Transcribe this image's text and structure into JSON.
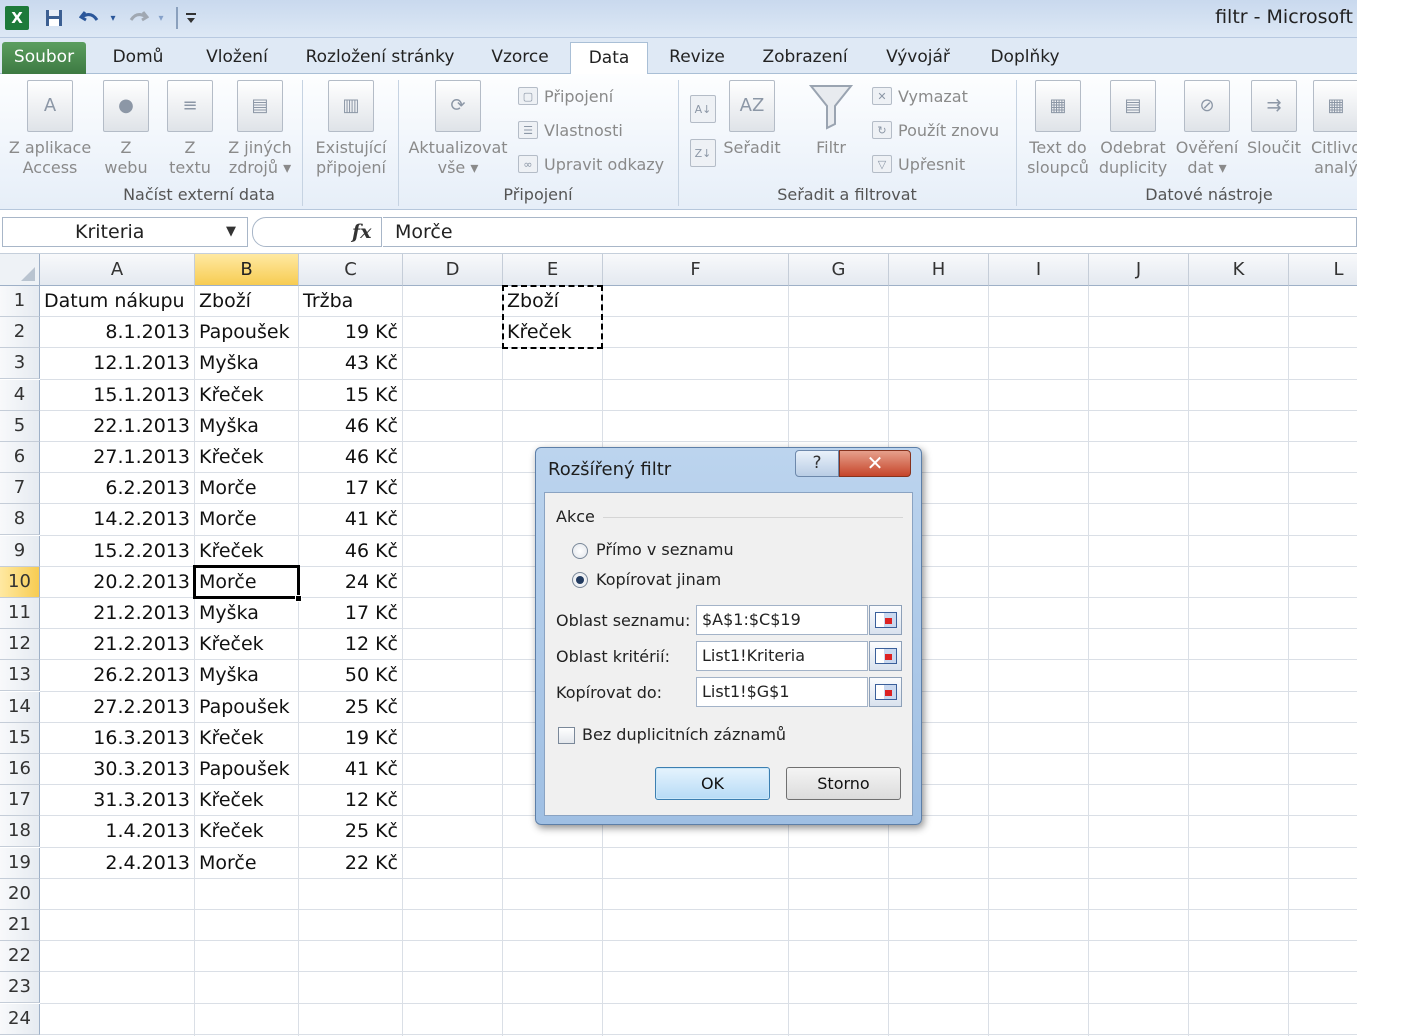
{
  "window": {
    "title": "filtr - Microsoft",
    "app_icon": "excel-icon"
  },
  "quick_access": {
    "icons": [
      "save-icon",
      "undo-icon",
      "redo-icon",
      "customize-icon"
    ]
  },
  "tabs": [
    {
      "label": "Soubor",
      "kind": "file"
    },
    {
      "label": "Domů"
    },
    {
      "label": "Vložení"
    },
    {
      "label": "Rozložení stránky"
    },
    {
      "label": "Vzorce"
    },
    {
      "label": "Data",
      "active": true
    },
    {
      "label": "Revize"
    },
    {
      "label": "Zobrazení"
    },
    {
      "label": "Vývojář"
    },
    {
      "label": "Doplňky"
    }
  ],
  "ribbon": {
    "groups": {
      "external": "Načíst externí data",
      "connections": "Připojení",
      "sort_filter": "Seřadit a filtrovat",
      "tools": "Datové nástroje"
    },
    "external": {
      "access": [
        "Z aplikace",
        "Access"
      ],
      "web": [
        "Z",
        "webu"
      ],
      "text": [
        "Z",
        "textu"
      ],
      "other": [
        "Z jiných",
        "zdrojů ▾"
      ],
      "existing": [
        "Existující",
        "připojení"
      ]
    },
    "connections": {
      "refresh": [
        "Aktualizovat",
        "vše ▾"
      ],
      "connections": "Připojení",
      "properties": "Vlastnosti",
      "edit_links": "Upravit odkazy"
    },
    "sort_filter": {
      "sort": "Seřadit",
      "filter": "Filtr",
      "clear": "Vymazat",
      "reapply": "Použít znovu",
      "advanced": "Upřesnit"
    },
    "tools": {
      "text_to_columns": [
        "Text do",
        "sloupců"
      ],
      "remove_duplicates": [
        "Odebrat",
        "duplicity"
      ],
      "validation": [
        "Ověření",
        "dat ▾"
      ],
      "consolidate": [
        "Sloučit",
        ""
      ],
      "what_if": [
        "Citlivo",
        "analý"
      ]
    }
  },
  "formula_bar": {
    "name_box": "Kriteria",
    "fx": "fx",
    "formula": "Morče"
  },
  "sheet": {
    "columns": [
      "A",
      "B",
      "C",
      "D",
      "E",
      "F",
      "G",
      "H",
      "I",
      "J",
      "K",
      "L"
    ],
    "rows": [
      "1",
      "2",
      "3",
      "4",
      "5",
      "6",
      "7",
      "8",
      "9",
      "10",
      "11",
      "12",
      "13",
      "14",
      "15",
      "16",
      "17",
      "18",
      "19",
      "20",
      "21",
      "22",
      "23",
      "24"
    ],
    "headers": [
      "Datum nákupu",
      "Zboží",
      "Tržba"
    ],
    "data": [
      [
        "8.1.2013",
        "Papoušek",
        "19 Kč"
      ],
      [
        "12.1.2013",
        "Myška",
        "43 Kč"
      ],
      [
        "15.1.2013",
        "Křeček",
        "15 Kč"
      ],
      [
        "22.1.2013",
        "Myška",
        "46 Kč"
      ],
      [
        "27.1.2013",
        "Křeček",
        "46 Kč"
      ],
      [
        "6.2.2013",
        "Morče",
        "17 Kč"
      ],
      [
        "14.2.2013",
        "Morče",
        "41 Kč"
      ],
      [
        "15.2.2013",
        "Křeček",
        "46 Kč"
      ],
      [
        "20.2.2013",
        "Morče",
        "24 Kč"
      ],
      [
        "21.2.2013",
        "Myška",
        "17 Kč"
      ],
      [
        "21.2.2013",
        "Křeček",
        "12 Kč"
      ],
      [
        "26.2.2013",
        "Myška",
        "50 Kč"
      ],
      [
        "27.2.2013",
        "Papoušek",
        "25 Kč"
      ],
      [
        "16.3.2013",
        "Křeček",
        "19 Kč"
      ],
      [
        "30.3.2013",
        "Papoušek",
        "41 Kč"
      ],
      [
        "31.3.2013",
        "Křeček",
        "12 Kč"
      ],
      [
        "1.4.2013",
        "Křeček",
        "25 Kč"
      ],
      [
        "2.4.2013",
        "Morče",
        "22 Kč"
      ]
    ],
    "criteria": [
      "Zboží",
      "Křeček"
    ],
    "active_cell": "B10"
  },
  "dialog": {
    "title": "Rozšířený filtr",
    "help": "?",
    "close": "✕",
    "section": "Akce",
    "option_in_place": "Přímo v seznamu",
    "option_copy": "Kopírovat jinam",
    "selected_option": "copy",
    "list_range_label": "Oblast seznamu:",
    "list_range_value": "$A$1:$C$19",
    "criteria_range_label": "Oblast kritérií:",
    "criteria_range_value": "List1!Kriteria",
    "copy_to_label": "Kopírovat do:",
    "copy_to_value": "List1!$G$1",
    "unique_label": "Bez duplicitních záznamů",
    "unique_checked": false,
    "ok": "OK",
    "cancel": "Storno"
  }
}
